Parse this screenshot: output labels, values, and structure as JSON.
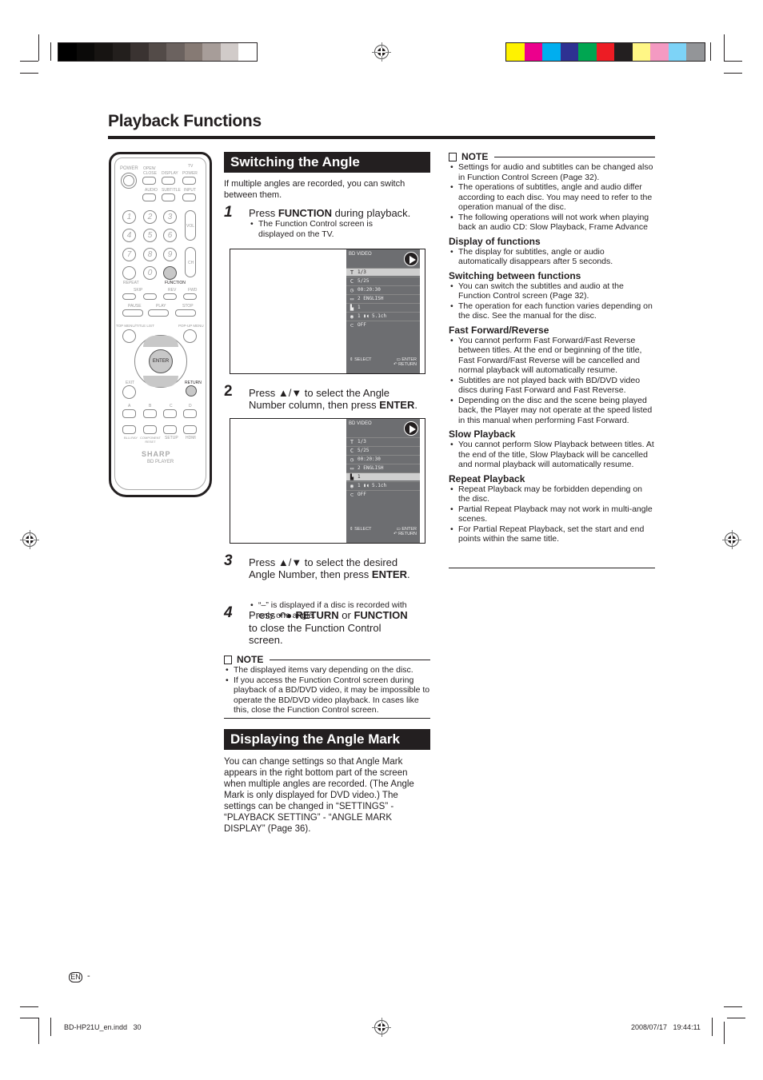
{
  "page": {
    "title": "Playback Functions",
    "language_badge": "EN",
    "page_dash": "-",
    "footer_file": "BD-HP21U_en.indd   30",
    "footer_datetime": "2008/07/17   19:44:11"
  },
  "color_bars": {
    "grayscale": [
      "#000000",
      "#0b0a09",
      "#171412",
      "#231f1d",
      "#3a3331",
      "#534b48",
      "#6b625f",
      "#867a74",
      "#a79d99",
      "#d1cbc9",
      "#ffffff"
    ],
    "process": [
      "#fff200",
      "#ec008c",
      "#00aeef",
      "#2e3192",
      "#00a651",
      "#ed1c24",
      "#231f20",
      "#fff685",
      "#f49ac2",
      "#7dd3f7",
      "#939598"
    ]
  },
  "remote": {
    "brand": "SHARP",
    "model_label": "BD PLAYER",
    "labels": {
      "power": "POWER",
      "open_close": "OPEN/ CLOSE",
      "display": "DISPLAY",
      "tv": "TV",
      "tv_power": "POWER",
      "audio": "AUDIO",
      "subtitle": "SUBTITLE",
      "input": "INPUT",
      "vol": "VOL",
      "ch": "CH",
      "repeat": "REPEAT",
      "function": "FUNCTION",
      "skip": "SKIP",
      "rev": "REV",
      "fwd": "FWD",
      "pause": "PAUSE",
      "play": "PLAY",
      "stop": "STOP",
      "top_menu": "TOP MENU/TITLE LIST",
      "popup_menu": "POP-UP MENU",
      "enter": "ENTER",
      "exit": "EXIT",
      "return": "RETURN",
      "a": "A",
      "b": "B",
      "c": "C",
      "d": "D",
      "bluray": "Blu-ray",
      "component_reset": "COMPONENT RESET",
      "setup": "SETUP",
      "hdmi": "HDMI"
    },
    "digits": [
      "1",
      "2",
      "3",
      "4",
      "5",
      "6",
      "7",
      "8",
      "9",
      "0"
    ]
  },
  "switching_angle": {
    "heading": "Switching the Angle",
    "intro": "If multiple angles are recorded, you can switch between them.",
    "steps": [
      {
        "num": "1",
        "pre": "Press ",
        "bold": "FUNCTION",
        "post": " during playback.",
        "sub": "The Function Control screen is displayed on the TV."
      },
      {
        "num": "2",
        "line1": "Press ▲/▼ to select the Angle",
        "line2_pre": "Number column, then press ",
        "line2_bold": "ENTER",
        "line2_post": "."
      },
      {
        "num": "3",
        "line1": "Press ▲/▼ to select the desired",
        "line2_pre": "Angle Number, then press ",
        "line2_bold": "ENTER",
        "line2_post": ".",
        "sub": "“–” is displayed if a disc is recorded with only one angle."
      },
      {
        "num": "4",
        "pre": "Press ",
        "bold1": "RETURN",
        "mid": " or ",
        "bold2": "FUNCTION",
        "post": "to close the Function Control screen."
      }
    ],
    "note": {
      "title": "NOTE",
      "items": [
        "The displayed items vary depending on the disc.",
        "If you access the Function Control screen during playback of a BD/DVD video, it may be impossible to operate the BD/DVD video playback. In cases like this, close the Function Control screen."
      ]
    }
  },
  "function_screens": [
    {
      "header": "BD VIDEO",
      "selected_row": 0,
      "rows": [
        {
          "icon": "title-icon",
          "glyph": "T",
          "value": "1/3"
        },
        {
          "icon": "chapter-icon",
          "glyph": "C",
          "value": "5/25"
        },
        {
          "icon": "time-icon",
          "glyph": "◷",
          "value": "00:20:30"
        },
        {
          "icon": "subtitle-icon",
          "glyph": "▭",
          "value": "2 ENGLISH"
        },
        {
          "icon": "angle-icon",
          "glyph": "▙",
          "value": "1"
        },
        {
          "icon": "audio-icon",
          "glyph": "◉",
          "value": "1  ▮◖  5.1ch"
        },
        {
          "icon": "repeat-icon",
          "glyph": "⊂",
          "value": "OFF"
        }
      ],
      "footer": {
        "select": "SELECT",
        "enter": "ENTER",
        "return": "RETURN"
      }
    },
    {
      "header": "BD VIDEO",
      "selected_row": 4,
      "rows": [
        {
          "icon": "title-icon",
          "glyph": "T",
          "value": "1/3"
        },
        {
          "icon": "chapter-icon",
          "glyph": "C",
          "value": "5/25"
        },
        {
          "icon": "time-icon",
          "glyph": "◷",
          "value": "00:20:30"
        },
        {
          "icon": "subtitle-icon",
          "glyph": "▭",
          "value": "2 ENGLISH"
        },
        {
          "icon": "angle-icon",
          "glyph": "▙",
          "value": "1"
        },
        {
          "icon": "audio-icon",
          "glyph": "◉",
          "value": "1  ▮◖  5.1ch"
        },
        {
          "icon": "repeat-icon",
          "glyph": "⊂",
          "value": "OFF"
        }
      ],
      "footer": {
        "select": "SELECT",
        "enter": "ENTER",
        "return": "RETURN"
      }
    }
  ],
  "angle_mark": {
    "heading": "Displaying the Angle Mark",
    "body": "You can change settings so that Angle Mark appears in the right bottom part of the screen when multiple angles are recorded. (The Angle Mark is only displayed for DVD video.) The settings can be changed in “SETTINGS” - “PLAYBACK SETTING” - “ANGLE MARK DISPLAY” (Page 36)."
  },
  "right_column": {
    "note_title": "NOTE",
    "note_items": [
      "Settings for audio and subtitles can be changed also in Function Control Screen (Page 32).",
      "The operations of subtitles, angle and audio differ according to each disc. You may need to refer to the operation manual of the disc.",
      "The following operations will not work when playing back an audio CD: Slow Playback, Frame Advance"
    ],
    "sections": [
      {
        "title": "Display of functions",
        "items": [
          "The display for subtitles, angle or audio automatically disappears after 5 seconds."
        ]
      },
      {
        "title": "Switching between functions",
        "items": [
          "You can switch the subtitles and audio at the Function Control screen (Page 32).",
          "The operation for each function varies depending on the disc. See the manual for the disc."
        ]
      },
      {
        "title": "Fast Forward/Reverse",
        "items": [
          "You cannot perform Fast Forward/Fast Reverse between titles. At the end or beginning of the title, Fast Forward/Fast Reverse will be cancelled and normal playback will automatically resume.",
          "Subtitles are not played back with BD/DVD video discs during Fast Forward and Fast Reverse.",
          "Depending on the disc and the scene being played back, the Player may not operate at the speed listed in this manual when performing Fast Forward."
        ]
      },
      {
        "title": "Slow Playback",
        "items": [
          "You cannot perform Slow Playback between titles. At the end of the title, Slow Playback will be cancelled and normal playback will automatically resume."
        ]
      },
      {
        "title": "Repeat Playback",
        "items": [
          "Repeat Playback may be forbidden depending on the disc.",
          "Partial Repeat Playback may not work in multi-angle scenes.",
          "For Partial Repeat Playback, set the start and end points within the same title."
        ]
      }
    ]
  }
}
